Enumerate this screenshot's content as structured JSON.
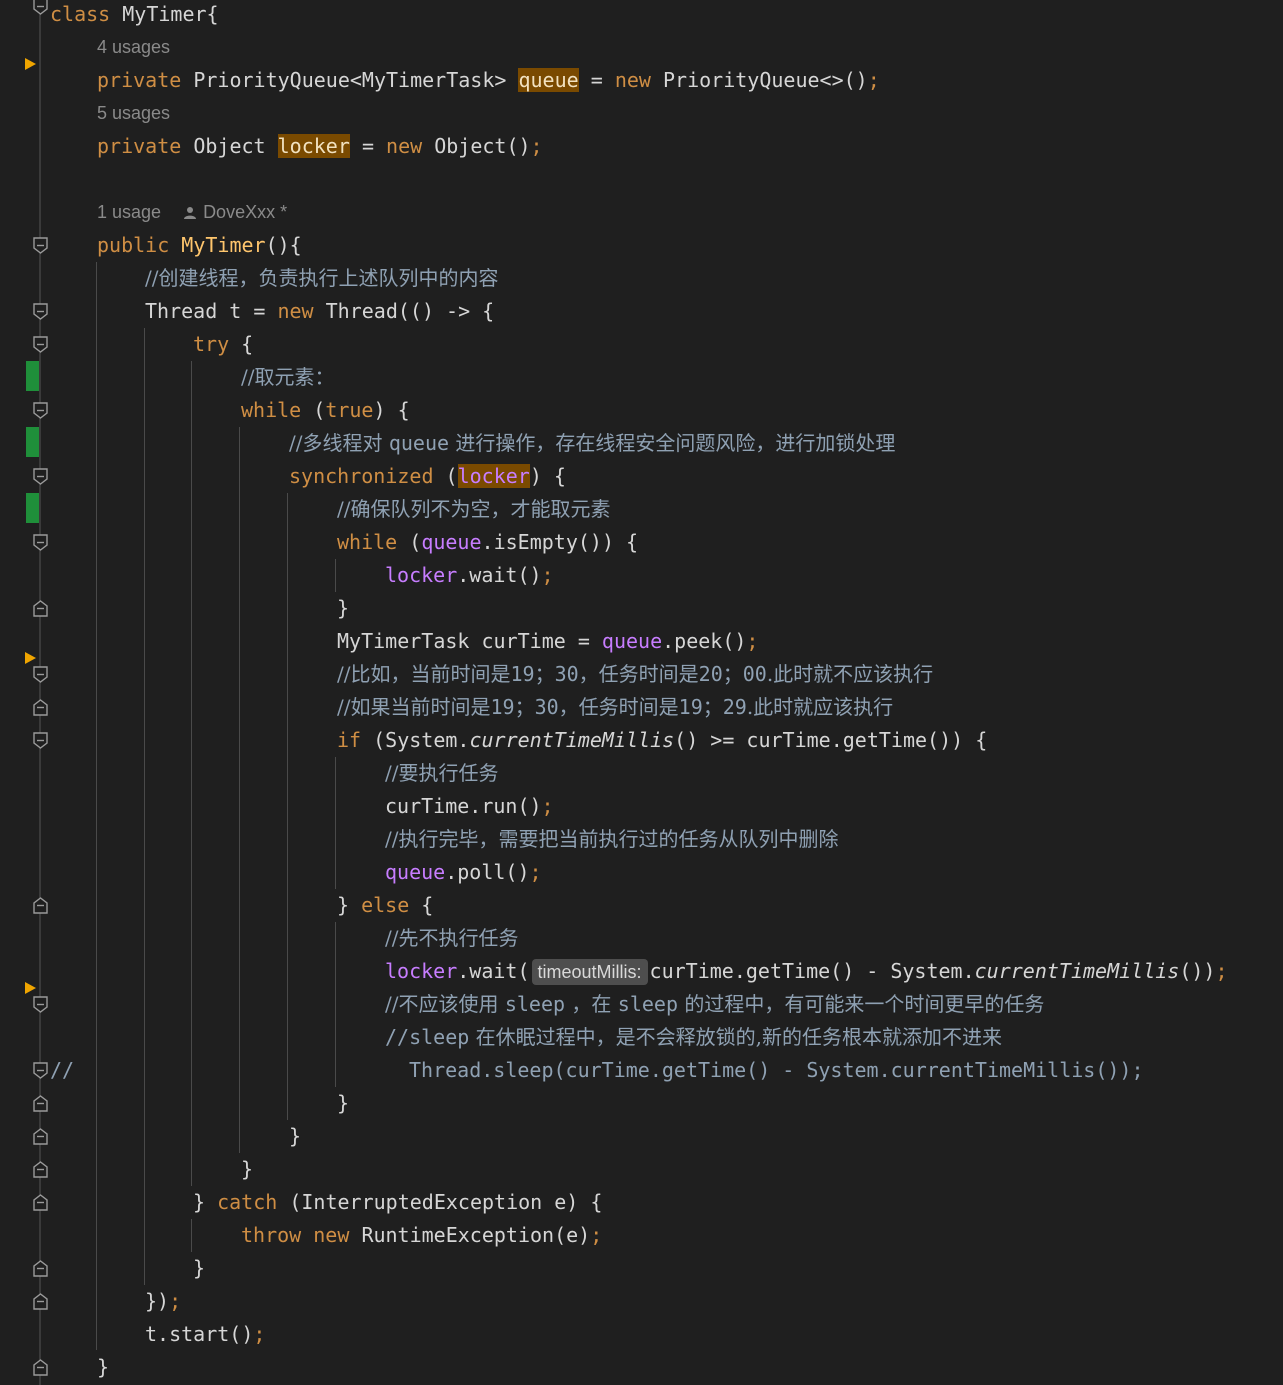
{
  "editor": {
    "language": "Java",
    "hints": {
      "usages_4": "4 usages",
      "usages_5": "5 usages",
      "usages_1": "1 usage",
      "author": "DoveXxx *"
    },
    "code": {
      "class_kw": "class",
      "class_name": "MyTimer{",
      "private_kw": "private",
      "queue_type": "PriorityQueue<MyTimerTask>",
      "queue_name": "queue",
      "eq": "=",
      "new_kw": "new",
      "queue_init": "PriorityQueue<>()",
      "semicolon": ";",
      "object_type": "Object",
      "locker_name": "locker",
      "object_init": "Object()",
      "public_kw": "public",
      "ctor_name": "MyTimer",
      "ctor_tail": "(){",
      "comment_create_thread": "//创建线程，负责执行上述队列中的内容",
      "thread_decl": "Thread t = ",
      "thread_init": "Thread(() -> {",
      "try_kw": "try",
      "open_brace": " {",
      "comment_take": "//取元素：",
      "while_kw": "while",
      "true_kw": "true",
      "while_true_tail": ") {",
      "comment_multi_a": "//多线程对 ",
      "comment_multi_queue": "queue",
      "comment_multi_b": " 进行操作，存在线程安全问题风险，进行加锁处理",
      "sync_kw": "synchronized",
      "sync_tail": ") {",
      "comment_ensure": "//确保队列不为空，才能取元素",
      "isempty": ".isEmpty()) {",
      "wait_call": ".wait()",
      "close_brace": "}",
      "curtime_decl": "MyTimerTask curTime = ",
      "peek_call": ".peek()",
      "comment_eg1_a": "//比如，当前时间是",
      "comment_eg1_b": "19；30",
      "comment_eg1_c": "，任务时间是",
      "comment_eg1_d": "20；00",
      "comment_eg1_e": ".此时就不应该执行",
      "comment_eg2_a": "//如果当前时间是",
      "comment_eg2_b": "19；30",
      "comment_eg2_c": "，任务时间是",
      "comment_eg2_d": "19；29",
      "comment_eg2_e": ".此时就应该执行",
      "if_kw": "if",
      "if_a": " (System.",
      "ctm": "currentTimeMillis",
      "if_b": "() >= curTime.getTime()) {",
      "comment_exec": "//要执行任务",
      "run_call": "curTime.run()",
      "comment_done": "//执行完毕，需要把当前执行过的任务从队列中删除",
      "poll_call": ".poll()",
      "else_open": "} ",
      "else_kw": "else",
      "comment_notexec": "//先不执行任务",
      "wait_open": ".wait(",
      "inlay_timeout": "timeoutMillis:",
      "wait_args_a": "curTime.getTime() - System.",
      "wait_args_b": "())",
      "comment_nosleep_a": "//不应该使用 ",
      "comment_nosleep_b": "sleep",
      "comment_nosleep_c": " ，在 ",
      "comment_nosleep_d": "sleep",
      "comment_nosleep_e": " 的过程中，有可能来一个时间更早的任务",
      "comment_sleep_a": "//sleep",
      "comment_sleep_b": " 在休眠过程中，是不会释放锁的,新的任务根本就添加不进来",
      "commented_prefix": "//",
      "commented_code": "Thread.sleep(curTime.getTime() - System.currentTimeMillis());",
      "catch_open": "} ",
      "catch_kw": "catch",
      "catch_tail": " (InterruptedException e) {",
      "throw_kw": "throw",
      "throw_tail": "RuntimeException(e)",
      "lambda_close": "})",
      "start_call": "t.start()"
    }
  }
}
